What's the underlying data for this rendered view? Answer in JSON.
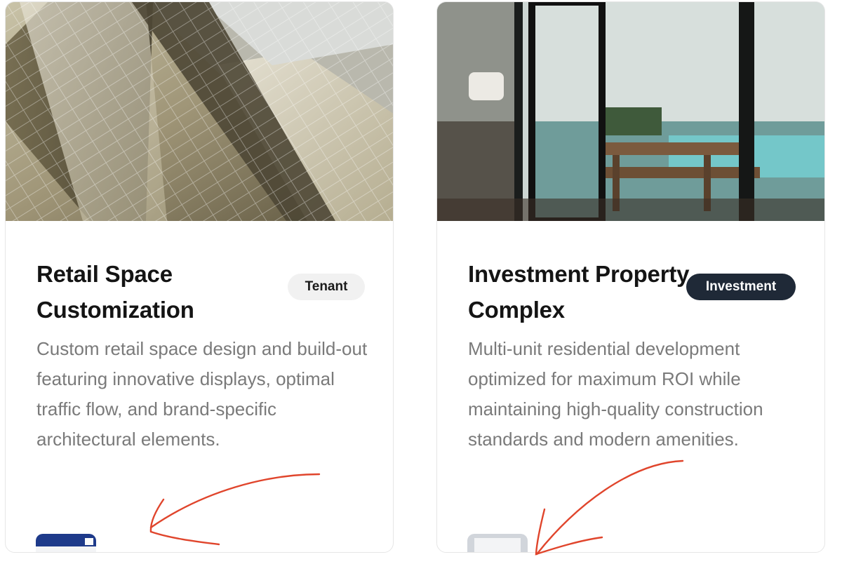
{
  "cards": [
    {
      "title": "Retail Space Customization",
      "badge": "Tenant",
      "description": "Custom retail space design and build-out featuring innovative displays, optimal traffic flow, and brand-specific architectural elements."
    },
    {
      "title": "Investment Property Complex",
      "badge": "Investment",
      "description": "Multi-unit residential development optimized for maximum ROI while maintaining high-quality construction standards and modern amenities."
    }
  ],
  "colors": {
    "badge_dark_bg": "#1f2937",
    "badge_light_bg": "#f1f1f1",
    "annotation_arrow": "#e0452c"
  }
}
